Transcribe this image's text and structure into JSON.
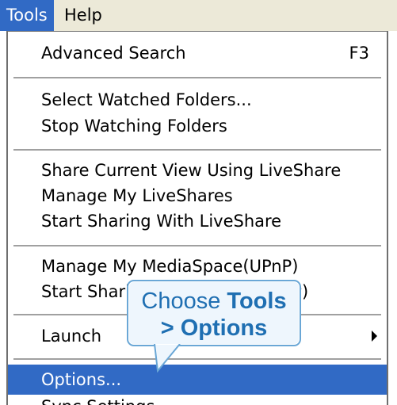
{
  "menubar": {
    "items": [
      {
        "label": "Tools"
      },
      {
        "label": "Help"
      }
    ]
  },
  "menu": {
    "items": [
      {
        "label": "Advanced Search",
        "shortcut": "F3"
      },
      {
        "label": "Select Watched Folders..."
      },
      {
        "label": "Stop Watching Folders"
      },
      {
        "label": "Share Current View Using LiveShare"
      },
      {
        "label": "Manage My LiveShares"
      },
      {
        "label": "Start Sharing With LiveShare"
      },
      {
        "label": "Manage My MediaSpace(UPnP)"
      },
      {
        "label": "Start Sharin",
        "label_tail": "nP)"
      },
      {
        "label": "Launch"
      },
      {
        "label": "Options..."
      },
      {
        "label": "Sync Settings..."
      }
    ]
  },
  "callout": {
    "line1_prefix": "Choose ",
    "line1_bold": "Tools",
    "line2": "> Options"
  },
  "colors": {
    "highlight": "#316ac5",
    "menubar_bg": "#ece9d8",
    "callout_text": "#1f6fb2",
    "callout_border": "#6aa7d6"
  }
}
